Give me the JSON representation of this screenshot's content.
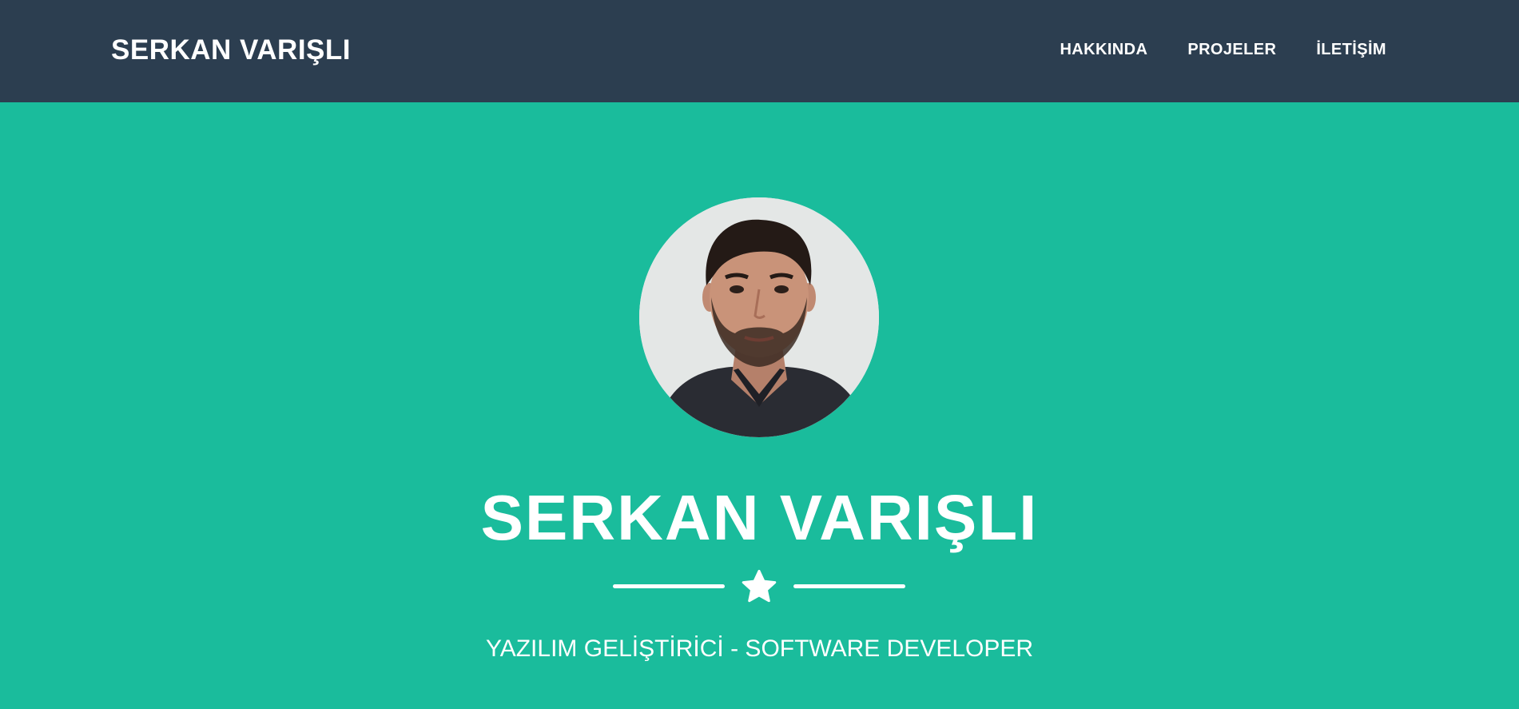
{
  "header": {
    "brand": "SERKAN VARIŞLI",
    "nav": [
      {
        "label": "HAKKINDA"
      },
      {
        "label": "PROJELER"
      },
      {
        "label": "İLETİŞİM"
      }
    ]
  },
  "hero": {
    "title": "SERKAN VARIŞLI",
    "divider_icon": "star-icon",
    "subtitle": "YAZILIM GELİŞTİRİCİ - SOFTWARE DEVELOPER"
  },
  "colors": {
    "navbar": "#2c3e50",
    "hero_background": "#1abc9c",
    "text": "#ffffff"
  }
}
